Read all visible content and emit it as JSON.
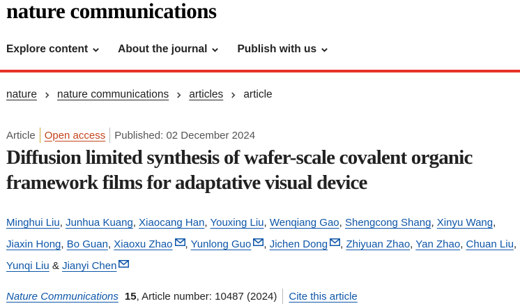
{
  "header": {
    "logo_text": "nature communications"
  },
  "nav": {
    "items": [
      {
        "label": "Explore content"
      },
      {
        "label": "About the journal"
      },
      {
        "label": "Publish with us"
      }
    ]
  },
  "breadcrumb": {
    "items": [
      "nature",
      "nature communications",
      "articles"
    ],
    "current": "article"
  },
  "article": {
    "type": "Article",
    "access": "Open access",
    "published": "Published: 02 December 2024",
    "title": "Diffusion limited synthesis of wafer-scale covalent organic framework films for adaptative visual device",
    "authors": [
      {
        "name": "Minghui Liu",
        "sep": ", "
      },
      {
        "name": "Junhua Kuang",
        "sep": ", "
      },
      {
        "name": "Xiaocang Han",
        "sep": ", "
      },
      {
        "name": "Youxing Liu",
        "sep": ", "
      },
      {
        "name": "Wenqiang Gao",
        "sep": ", "
      },
      {
        "name": "Shengcong Shang",
        "sep": ", "
      },
      {
        "name": "Xinyu Wang",
        "sep": ", "
      },
      {
        "name": "Jiaxin Hong",
        "sep": ", "
      },
      {
        "name": "Bo Guan",
        "sep": ", "
      },
      {
        "name": "Xiaoxu Zhao",
        "sep": ", "
      },
      {
        "name": "Yunlong Guo",
        "sep": ", "
      },
      {
        "name": "Jichen Dong",
        "sep": ", "
      },
      {
        "name": "Zhiyuan Zhao",
        "sep": ", "
      },
      {
        "name": "Yan Zhao",
        "sep": ", "
      },
      {
        "name": "Chuan Liu",
        "sep": ", "
      },
      {
        "name": "Yunqi Liu",
        "sep": " & "
      },
      {
        "name": "Jianyi Chen",
        "sep": ""
      }
    ],
    "journal": "Nature Communications",
    "volume": "15",
    "article_number": ", Article number: 10487 (2024)",
    "cite_label": "Cite this article"
  },
  "colors": {
    "accent_red": "#e6332a",
    "link_blue": "#0e56a8",
    "open_access": "#c4441c"
  }
}
